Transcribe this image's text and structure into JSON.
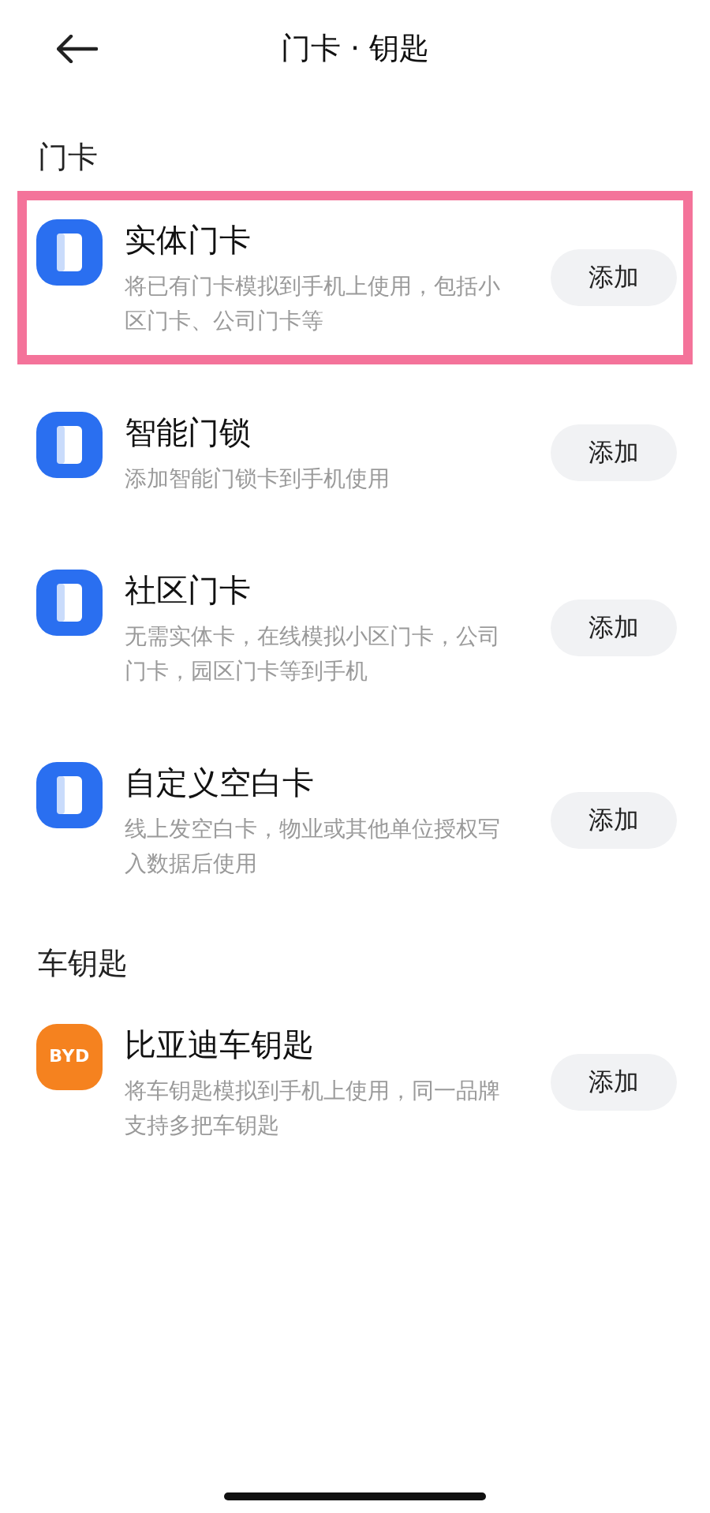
{
  "header": {
    "title": "门卡 · 钥匙"
  },
  "sections": [
    {
      "title": "门卡",
      "items": [
        {
          "kind": "card",
          "title": "实体门卡",
          "description": "将已有门卡模拟到手机上使用，包括小区门卡、公司门卡等",
          "button": "添加",
          "highlighted": true
        },
        {
          "kind": "card",
          "title": "智能门锁",
          "description": "添加智能门锁卡到手机使用",
          "button": "添加",
          "highlighted": false
        },
        {
          "kind": "card",
          "title": "社区门卡",
          "description": "无需实体卡，在线模拟小区门卡，公司门卡，园区门卡等到手机",
          "button": "添加",
          "highlighted": false
        },
        {
          "kind": "card",
          "title": "自定义空白卡",
          "description": "线上发空白卡，物业或其他单位授权写入数据后使用",
          "button": "添加",
          "highlighted": false
        }
      ]
    },
    {
      "title": "车钥匙",
      "items": [
        {
          "kind": "car",
          "logo_text": "BYD",
          "title": "比亚迪车钥匙",
          "description": "将车钥匙模拟到手机上使用，同一品牌支持多把车钥匙",
          "button": "添加",
          "highlighted": false
        }
      ]
    }
  ]
}
